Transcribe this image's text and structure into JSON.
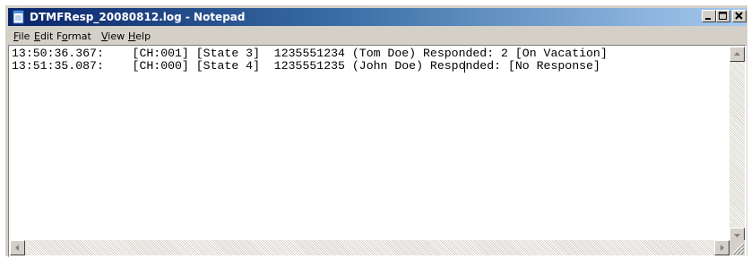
{
  "window": {
    "title": "DTMFResp_20080812.log - Notepad"
  },
  "menu": [
    {
      "label": "File",
      "mnemonic": "F",
      "rest": "ile"
    },
    {
      "label": "Edit",
      "mnemonic": "E",
      "rest": "dit"
    },
    {
      "label": "Format",
      "pre": "F",
      "mnemonic": "o",
      "rest": "rmat"
    },
    {
      "label": "View",
      "mnemonic": "V",
      "rest": "iew"
    },
    {
      "label": "Help",
      "mnemonic": "H",
      "rest": "elp"
    }
  ],
  "editor": {
    "lines": [
      "13:50:36.367:    [CH:001] [State 3]  1235551234 (Tom Doe) Responded: 2 [On Vacation]",
      "13:51:35.087:    [CH:000] [State 4]  1235551235 (John Doe) Responded: [No Response]"
    ]
  },
  "icons": {
    "app": "notepad-icon",
    "minimize": "minimize-icon",
    "maximize": "maximize-icon",
    "close": "close-icon"
  },
  "colors": {
    "titlebar_start": "#0a246a",
    "titlebar_end": "#a6caf0",
    "chrome": "#d4d0c8"
  }
}
